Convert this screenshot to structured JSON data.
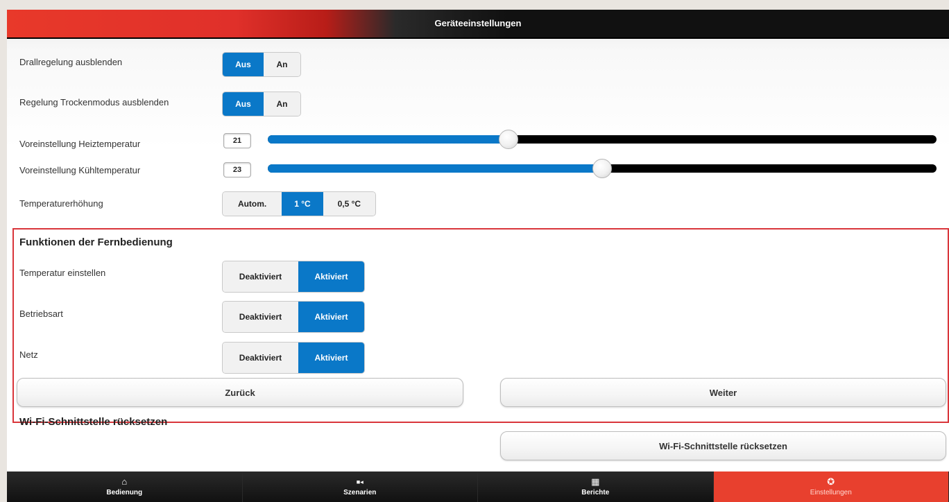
{
  "header": {
    "title": "Geräteeinstellungen"
  },
  "settings": {
    "swirl": {
      "label": "Drallregelung ausblenden",
      "options": [
        "Aus",
        "An"
      ],
      "selected": "Aus"
    },
    "dry": {
      "label": "Regelung Trockenmodus ausblenden",
      "options": [
        "Aus",
        "An"
      ],
      "selected": "Aus"
    },
    "heat": {
      "label": "Voreinstellung Heiztemperatur",
      "value": "21",
      "fraction": 0.36
    },
    "cool": {
      "label": "Voreinstellung Kühltemperatur",
      "value": "23",
      "fraction": 0.5
    },
    "increase": {
      "label": "Temperaturerhöhung",
      "options": [
        "Autom.",
        "1 °C",
        "0,5 °C"
      ],
      "selected": "1 °C"
    }
  },
  "remote": {
    "title": "Funktionen der Fernbedienung",
    "rows": [
      {
        "label": "Temperatur einstellen",
        "options": [
          "Deaktiviert",
          "Aktiviert"
        ],
        "selected": "Aktiviert"
      },
      {
        "label": "Betriebsart",
        "options": [
          "Deaktiviert",
          "Aktiviert"
        ],
        "selected": "Aktiviert"
      },
      {
        "label": "Netz",
        "options": [
          "Deaktiviert",
          "Aktiviert"
        ],
        "selected": "Aktiviert"
      }
    ],
    "back_label": "Zurück",
    "next_label": "Weiter"
  },
  "wifi": {
    "title": "Wi-Fi-Schnittstelle rücksetzen",
    "button_label": "Wi-Fi-Schnittstelle rücksetzen"
  },
  "tabs": [
    {
      "label": "Bedienung",
      "icon": "home-icon",
      "glyph": "⌂"
    },
    {
      "label": "Szenarien",
      "icon": "camera-icon",
      "glyph": "■◂"
    },
    {
      "label": "Berichte",
      "icon": "grid-icon",
      "glyph": "▦"
    },
    {
      "label": "Einstellungen",
      "icon": "gear-icon",
      "glyph": "✪"
    }
  ],
  "active_tab": "Einstellungen",
  "colors": {
    "accent": "#0a78c8",
    "brand": "#e8402e",
    "border_highlight": "#d9353a"
  }
}
